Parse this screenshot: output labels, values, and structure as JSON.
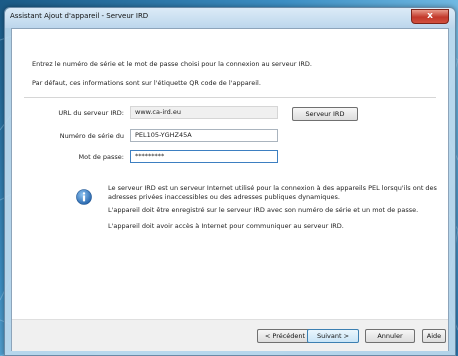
{
  "window": {
    "title": "Assistant Ajout d'appareil - Serveur IRD",
    "close_label": "x"
  },
  "intro": {
    "line1": "Entrez le numéro de série et le mot de passe choisi pour la connexion au serveur IRD.",
    "line2": "Par défaut, ces informations sont sur l'étiquette QR code de l'appareil."
  },
  "form": {
    "url_label": "URL du serveur IRD:",
    "url_value": "www.ca-ird.eu",
    "server_button": "Serveur IRD",
    "serial_label": "Numéro de série du",
    "serial_value": "PEL105-YGHZ45A",
    "password_label": "Mot de passe:",
    "password_value": "*********"
  },
  "info": {
    "p1_line1": "Le serveur IRD est un serveur Internet utilisé pour la connexion à des appareils PEL lorsqu'ils ont des",
    "p1_line2": "adresses privées inaccessibles ou des adresses publiques dynamiques.",
    "p2": "L'appareil doit être enregistré sur le serveur IRD avec son numéro de série et un mot de passe.",
    "p3": "L'appareil doit avoir accès à Internet pour communiquer au serveur IRD."
  },
  "buttons": {
    "previous": "< Précédent",
    "next": "Suivant >",
    "cancel": "Annuler",
    "help": "Aide"
  },
  "colors": {
    "accent": "#3d7fc1",
    "info_icon": "#2a6fb8"
  }
}
